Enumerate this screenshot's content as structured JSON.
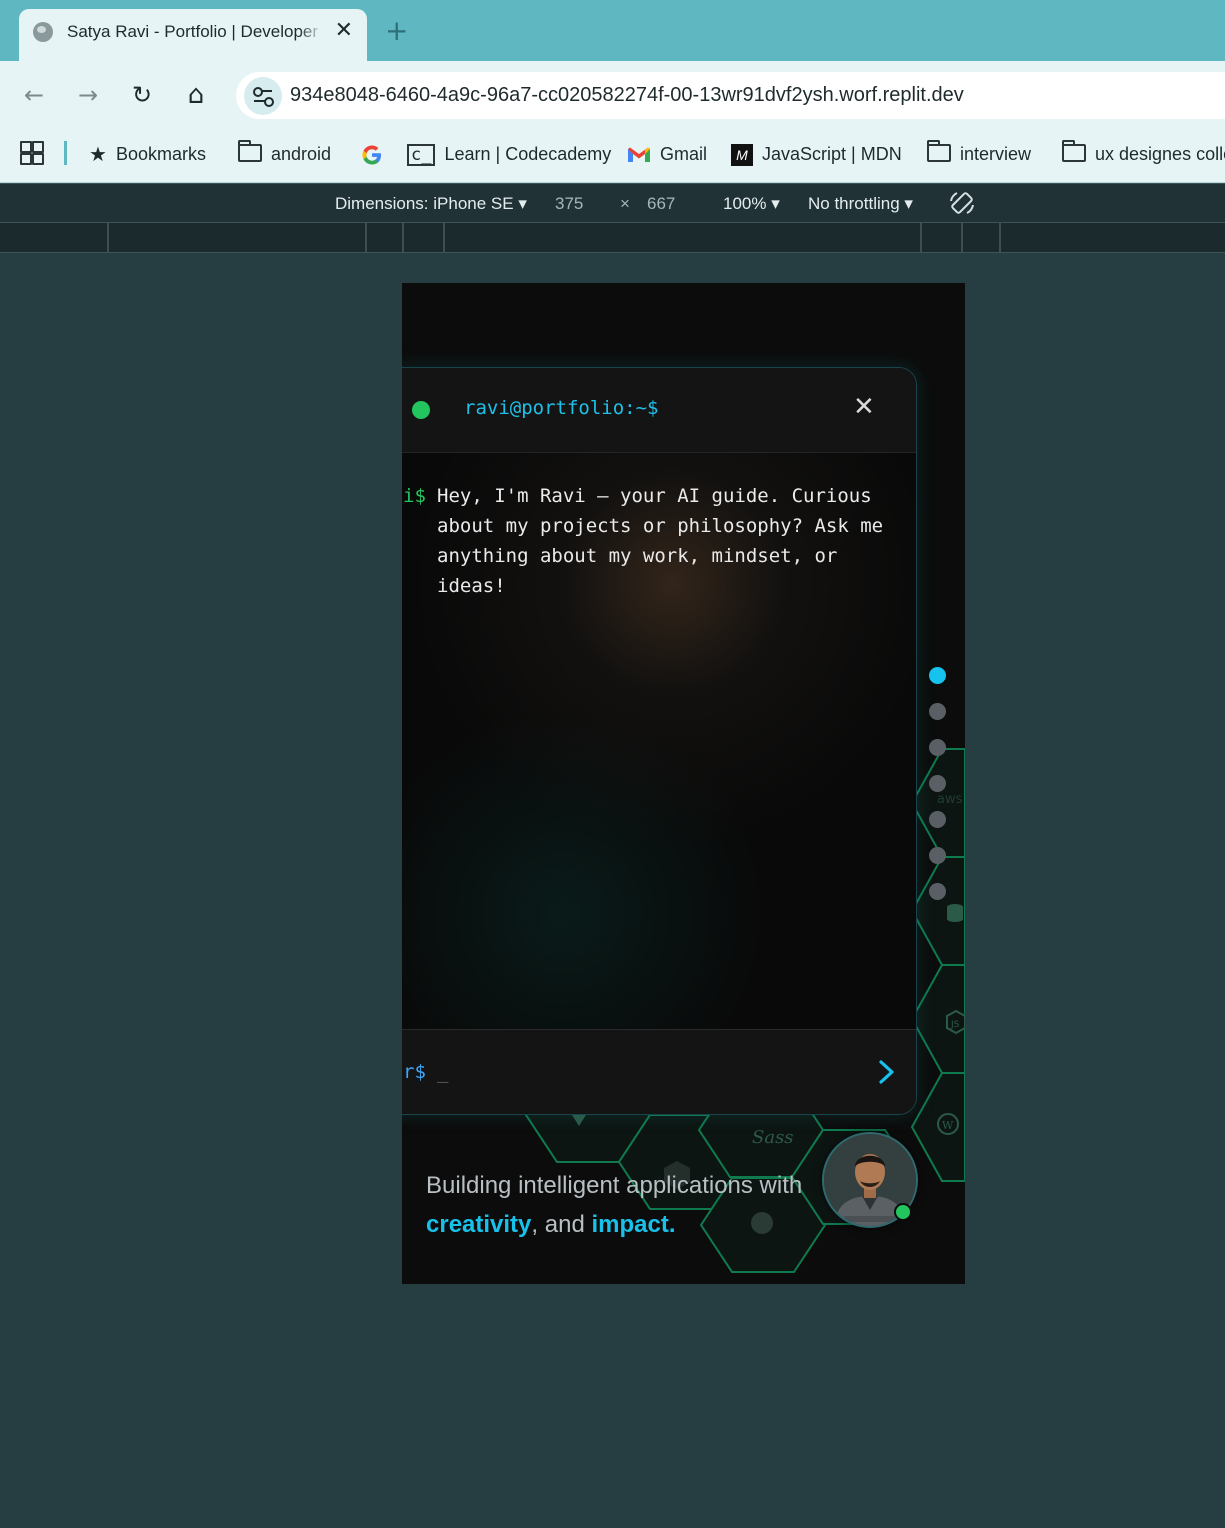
{
  "browser": {
    "tab_title": "Satya Ravi - Portfolio | Developer",
    "tab_close": "✕",
    "new_tab": "+",
    "url": "934e8048-6460-4a9c-96a7-cc020582274f-00-13wr91dvf2ysh.worf.replit.dev",
    "nav": {
      "back": "←",
      "forward": "→",
      "reload": "↻",
      "home": "⌂"
    }
  },
  "bookmarks": [
    {
      "label": "Bookmarks",
      "icon": "star-icon"
    },
    {
      "label": "android",
      "icon": "folder-icon"
    },
    {
      "label": "",
      "icon": "google-icon"
    },
    {
      "label": "Learn | Codecademy",
      "icon": "codecademy-icon"
    },
    {
      "label": "Gmail",
      "icon": "gmail-icon"
    },
    {
      "label": "JavaScript | MDN",
      "icon": "mdn-icon"
    },
    {
      "label": "interview",
      "icon": "folder-icon"
    },
    {
      "label": "ux designes colle",
      "icon": "folder-icon"
    }
  ],
  "devtools": {
    "dimensions_label": "Dimensions: iPhone SE",
    "width": "375",
    "times": "×",
    "height": "667",
    "zoom": "100%",
    "throttling": "No throttling"
  },
  "terminal": {
    "title": "ravi@portfolio:~$",
    "close": "✕",
    "message_prompt": "i$",
    "message": "Hey, I'm Ravi – your AI guide. Curious about my projects or philosophy? Ask me anything about my work, mindset, or ideas!",
    "input_prompt": "r$",
    "input_cursor": "_"
  },
  "section_nav": {
    "count": 7,
    "active_index": 0
  },
  "hero": {
    "tagline_start": "Building intelligent applications with",
    "highlight_1": "creativity",
    "middle": ", and ",
    "highlight_2": "impact",
    "end": "."
  },
  "tech_icons": [
    "aws-icon",
    "database-icon",
    "nodejs-icon",
    "wordpress-icon",
    "sass-icon",
    "brain-icon",
    "vue-icon"
  ],
  "colors": {
    "accent": "#18c1ea",
    "terminal_green": "#22c55e",
    "hex_green": "#0f7a4e",
    "page_bg": "#263d42"
  }
}
